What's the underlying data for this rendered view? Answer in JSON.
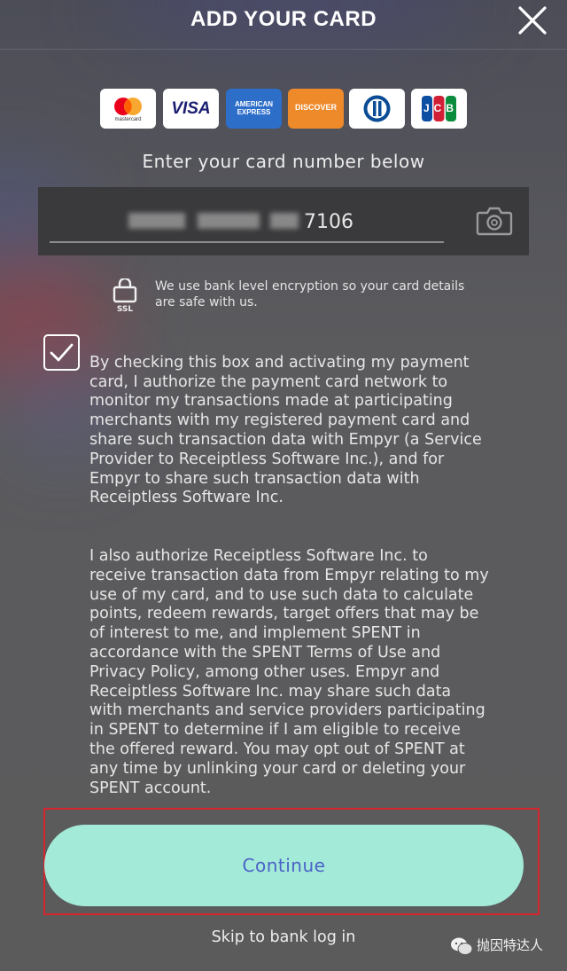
{
  "header": {
    "title": "ADD YOUR CARD",
    "close_icon": "close-icon"
  },
  "card_brands": [
    {
      "name": "mastercard",
      "label": "mastercard",
      "bg": "#ffffff"
    },
    {
      "name": "visa",
      "label": "VISA",
      "bg": "#ffffff"
    },
    {
      "name": "american-express",
      "label": "AMERICAN EXPRESS",
      "bg": "#2d6ec9"
    },
    {
      "name": "discover",
      "label": "DISCOVER",
      "bg": "#ef8a2b"
    },
    {
      "name": "diners-club",
      "label": "",
      "bg": "#ffffff"
    },
    {
      "name": "jcb",
      "label": "JCB",
      "bg": "#ffffff"
    }
  ],
  "card_entry": {
    "prompt": "Enter your card number below",
    "value": "7106",
    "camera_icon": "camera-icon"
  },
  "security": {
    "icon": "ssl-lock-icon",
    "icon_label": "SSL",
    "text": "We use bank level encryption so your card details are safe with us."
  },
  "consent": {
    "checked": true,
    "paragraph_1": "By checking this box and activating my payment\ncard, I authorize the payment card network to\nmonitor my transactions made at participating\nmerchants with my registered payment card and\nshare such transaction data with Empyr (a Service\nProvider to Receiptless Software Inc.), and for\nEmpyr to share such transaction data with\nReceiptless Software Inc.",
    "paragraph_2": "I also authorize Receiptless Software Inc. to\nreceive transaction data from Empyr relating to my\nuse of my card, and to use such data to calculate\npoints, redeem rewards, target offers that may be\nof interest to me, and implement SPENT in\naccordance with the SPENT Terms of Use and\nPrivacy Policy, among other uses. Empyr and\nReceiptless Software Inc. may share such data\nwith merchants and service providers participating\nin SPENT to determine if I am eligible to receive\nthe offered reward. You may opt out of SPENT at\nany time by unlinking your card or deleting your\nSPENT account."
  },
  "actions": {
    "continue_label": "Continue",
    "skip_label": "Skip to bank log in"
  },
  "watermark": {
    "text": "抛因特达人",
    "icon": "wechat-icon"
  },
  "colors": {
    "accent_button": "#a4ead8",
    "button_text": "#4b62c8",
    "highlight_box": "#d6252c"
  }
}
